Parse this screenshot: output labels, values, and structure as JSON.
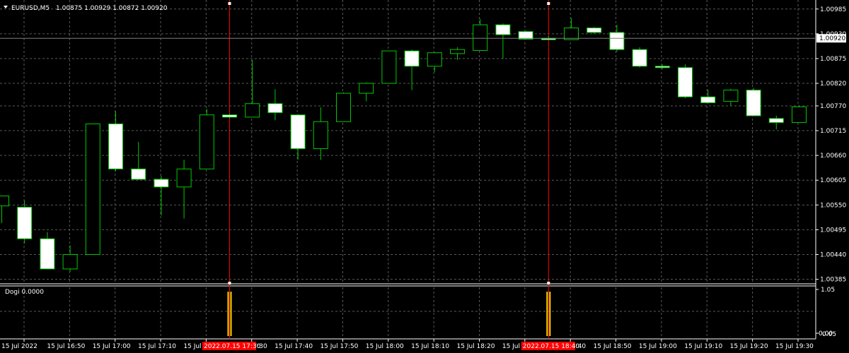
{
  "header": {
    "symbol_label": "EURUSD,M5",
    "ohlc_label": "1.00875 1.00929 1.00872 1.00920"
  },
  "indicator": {
    "label": "Dogi 0.0000",
    "scale_top": "1.05",
    "scale_bottom": "0.05",
    "scale_bottom_overlap": "0.00"
  },
  "colors": {
    "background": "#000000",
    "grid": "#5a5a5a",
    "frame": "#ffffff",
    "bull_fill": "#000000",
    "bear_fill": "#ffffff",
    "candle_outline": "#00c800",
    "wick": "#00c800",
    "vline": "#ff0000",
    "hist": "#ffd700",
    "tag_bg": "#ff0000",
    "price_line": "#7f7f7f"
  },
  "price_axis": {
    "labels": [
      "1.00985",
      "1.00930",
      "1.00875",
      "1.00820",
      "1.00770",
      "1.00715",
      "1.00660",
      "1.00605",
      "1.00550",
      "1.00495",
      "1.00440",
      "1.00385"
    ],
    "current_price": "1.00920"
  },
  "time_axis": {
    "labels": [
      "15 Jul 2022",
      "15 Jul 16:50",
      "15 Jul 17:00",
      "15 Jul 17:10",
      "15 Jul 17:20",
      "15 Jul 17:30",
      "15 Jul 17:40",
      "15 Jul 17:50",
      "15 Jul 18:00",
      "15 Jul 18:10",
      "15 Jul 18:20",
      "15 Jul 18:30",
      "15 Jul 18:40",
      "15 Jul 18:50",
      "15 Jul 19:00",
      "15 Jul 19:10",
      "15 Jul 19:20",
      "15 Jul 19:30"
    ],
    "vline_tags": [
      "2022.07.15 17:30",
      "2022.07.15 18:40"
    ]
  },
  "chart_data": {
    "type": "candlestick",
    "symbol": "EURUSD",
    "timeframe": "M5",
    "ylim": [
      1.00375,
      1.01005
    ],
    "candles": [
      {
        "o": 1.00548,
        "h": 1.0057,
        "l": 1.0051,
        "c": 1.0057
      },
      {
        "o": 1.00545,
        "h": 1.0056,
        "l": 1.00465,
        "c": 1.00475
      },
      {
        "o": 1.00475,
        "h": 1.0049,
        "l": 1.0041,
        "c": 1.00408
      },
      {
        "o": 1.00408,
        "h": 1.0046,
        "l": 1.00402,
        "c": 1.0044
      },
      {
        "o": 1.0044,
        "h": 1.0073,
        "l": 1.0044,
        "c": 1.0073
      },
      {
        "o": 1.0073,
        "h": 1.00758,
        "l": 1.00625,
        "c": 1.0063
      },
      {
        "o": 1.0063,
        "h": 1.0069,
        "l": 1.00605,
        "c": 1.00607
      },
      {
        "o": 1.00607,
        "h": 1.00615,
        "l": 1.00527,
        "c": 1.0059
      },
      {
        "o": 1.0059,
        "h": 1.0065,
        "l": 1.0052,
        "c": 1.0063
      },
      {
        "o": 1.0063,
        "h": 1.00763,
        "l": 1.0063,
        "c": 1.0075
      },
      {
        "o": 1.0075,
        "h": 1.00752,
        "l": 1.00742,
        "c": 1.00745
      },
      {
        "o": 1.00745,
        "h": 1.00872,
        "l": 1.00745,
        "c": 1.00775
      },
      {
        "o": 1.00775,
        "h": 1.00807,
        "l": 1.00738,
        "c": 1.00755
      },
      {
        "o": 1.0075,
        "h": 1.00752,
        "l": 1.0065,
        "c": 1.00675
      },
      {
        "o": 1.00675,
        "h": 1.00767,
        "l": 1.0065,
        "c": 1.00735
      },
      {
        "o": 1.00735,
        "h": 1.008,
        "l": 1.00735,
        "c": 1.00798
      },
      {
        "o": 1.00798,
        "h": 1.00822,
        "l": 1.0078,
        "c": 1.0082
      },
      {
        "o": 1.0082,
        "h": 1.00892,
        "l": 1.0082,
        "c": 1.00892
      },
      {
        "o": 1.00892,
        "h": 1.00895,
        "l": 1.00805,
        "c": 1.00858
      },
      {
        "o": 1.00858,
        "h": 1.00888,
        "l": 1.00845,
        "c": 1.00888
      },
      {
        "o": 1.00886,
        "h": 1.009,
        "l": 1.00872,
        "c": 1.00895
      },
      {
        "o": 1.00893,
        "h": 1.00963,
        "l": 1.00893,
        "c": 1.0095
      },
      {
        "o": 1.0095,
        "h": 1.00953,
        "l": 1.00875,
        "c": 1.00928
      },
      {
        "o": 1.00935,
        "h": 1.00937,
        "l": 1.00917,
        "c": 1.00918
      },
      {
        "o": 1.0092,
        "h": 1.00925,
        "l": 1.00917,
        "c": 1.00917
      },
      {
        "o": 1.00917,
        "h": 1.00965,
        "l": 1.00917,
        "c": 1.00943
      },
      {
        "o": 1.00943,
        "h": 1.00945,
        "l": 1.0093,
        "c": 1.00933
      },
      {
        "o": 1.00933,
        "h": 1.0095,
        "l": 1.0089,
        "c": 1.00895
      },
      {
        "o": 1.00895,
        "h": 1.009,
        "l": 1.00855,
        "c": 1.00858
      },
      {
        "o": 1.00858,
        "h": 1.00862,
        "l": 1.00852,
        "c": 1.00855
      },
      {
        "o": 1.00855,
        "h": 1.00862,
        "l": 1.00787,
        "c": 1.0079
      },
      {
        "o": 1.0079,
        "h": 1.00806,
        "l": 1.00775,
        "c": 1.00777
      },
      {
        "o": 1.0078,
        "h": 1.00808,
        "l": 1.0077,
        "c": 1.00805
      },
      {
        "o": 1.00805,
        "h": 1.0081,
        "l": 1.00748,
        "c": 1.00748
      },
      {
        "o": 1.00742,
        "h": 1.00748,
        "l": 1.00718,
        "c": 1.00733
      },
      {
        "o": 1.00733,
        "h": 1.0077,
        "l": 1.00733,
        "c": 1.00768
      }
    ],
    "vertical_lines_at_candle": [
      10,
      24
    ],
    "indicator": {
      "name": "Dogi",
      "ylim": [
        0,
        1.05
      ],
      "bars": [
        {
          "candle": 10,
          "value": 1
        },
        {
          "candle": 24,
          "value": 1
        }
      ]
    }
  }
}
